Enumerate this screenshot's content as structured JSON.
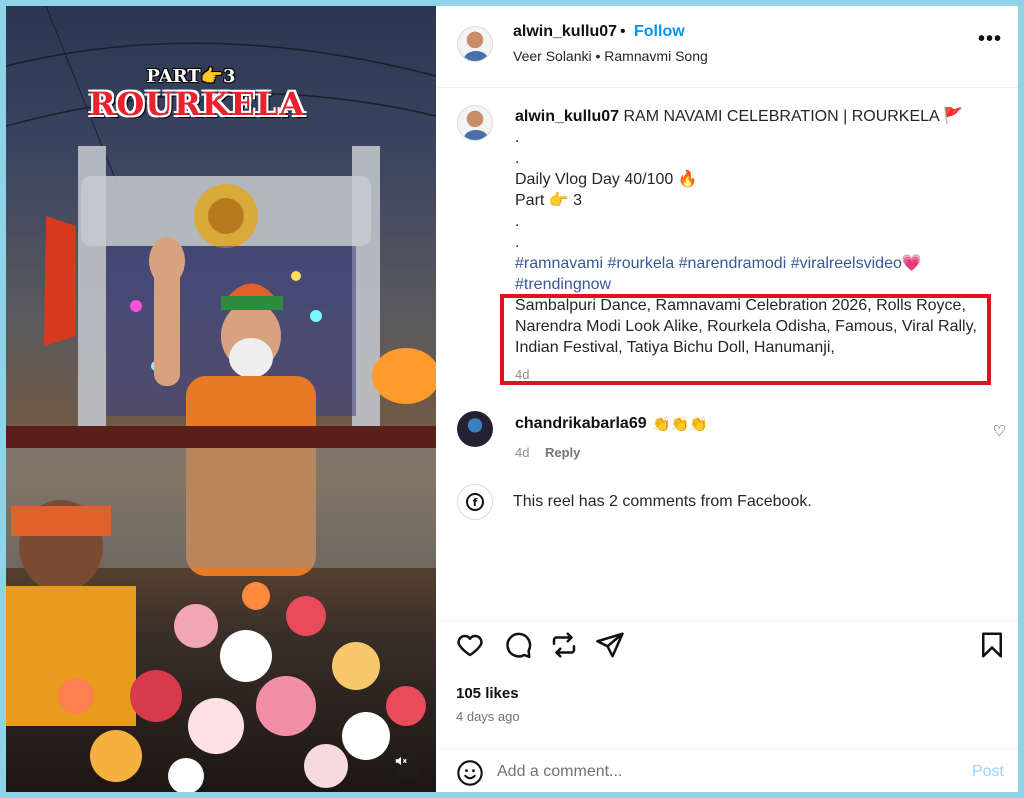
{
  "video": {
    "overlay_part": "PART👉3",
    "overlay_city": "ROURKELA",
    "mute_icon": "speaker-muted-icon"
  },
  "header": {
    "username": "alwin_kullu07",
    "separator": "•",
    "follow_label": "Follow",
    "subtitle": "Veer Solanki • Ramnavmi Song",
    "more_icon": "more-options-icon",
    "more_glyph": "•••"
  },
  "caption": {
    "username": "alwin_kullu07",
    "title": "RAM NAVAMI CELEBRATION | ROURKELA 🚩",
    "dot1": ".",
    "dot2": ".",
    "vlog": "Daily Vlog Day 40/100 🔥",
    "part": "Part 👉 3",
    "dot3": ".",
    "dot4": ".",
    "hashtags": "#ramnavami #rourkela #narendramodi #viralreelsvideo💗 #trendingnow",
    "keywords": "Sambalpuri Dance, Ramnavami Celebration 2026, Rolls Royce, Narendra Modi Look Alike, Rourkela Odisha, Famous, Viral Rally, Indian Festival, Tatiya Bichu Doll, Hanumanji,",
    "time": "4d"
  },
  "comment": {
    "username": "chandrikabarla69",
    "emojis": "👏👏👏",
    "time": "4d",
    "reply_label": "Reply",
    "heart_glyph": "♡"
  },
  "facebook": {
    "icon": "facebook-icon",
    "glyph": "f",
    "text": "This reel has 2 comments from Facebook."
  },
  "actions": {
    "like_icon": "heart-icon",
    "comment_icon": "comment-icon",
    "share_icon": "repost-icon",
    "send_icon": "send-icon",
    "save_icon": "bookmark-icon"
  },
  "stats": {
    "likes": "105 likes",
    "posted": "4 days ago"
  },
  "add_comment": {
    "placeholder": "Add a comment...",
    "post_label": "Post",
    "post_color": "#9ed0fa"
  },
  "colors": {
    "accent": "#0095f6",
    "hashtag": "#385898",
    "highlight": "#e0121b",
    "frame": "#8fd3e8"
  }
}
